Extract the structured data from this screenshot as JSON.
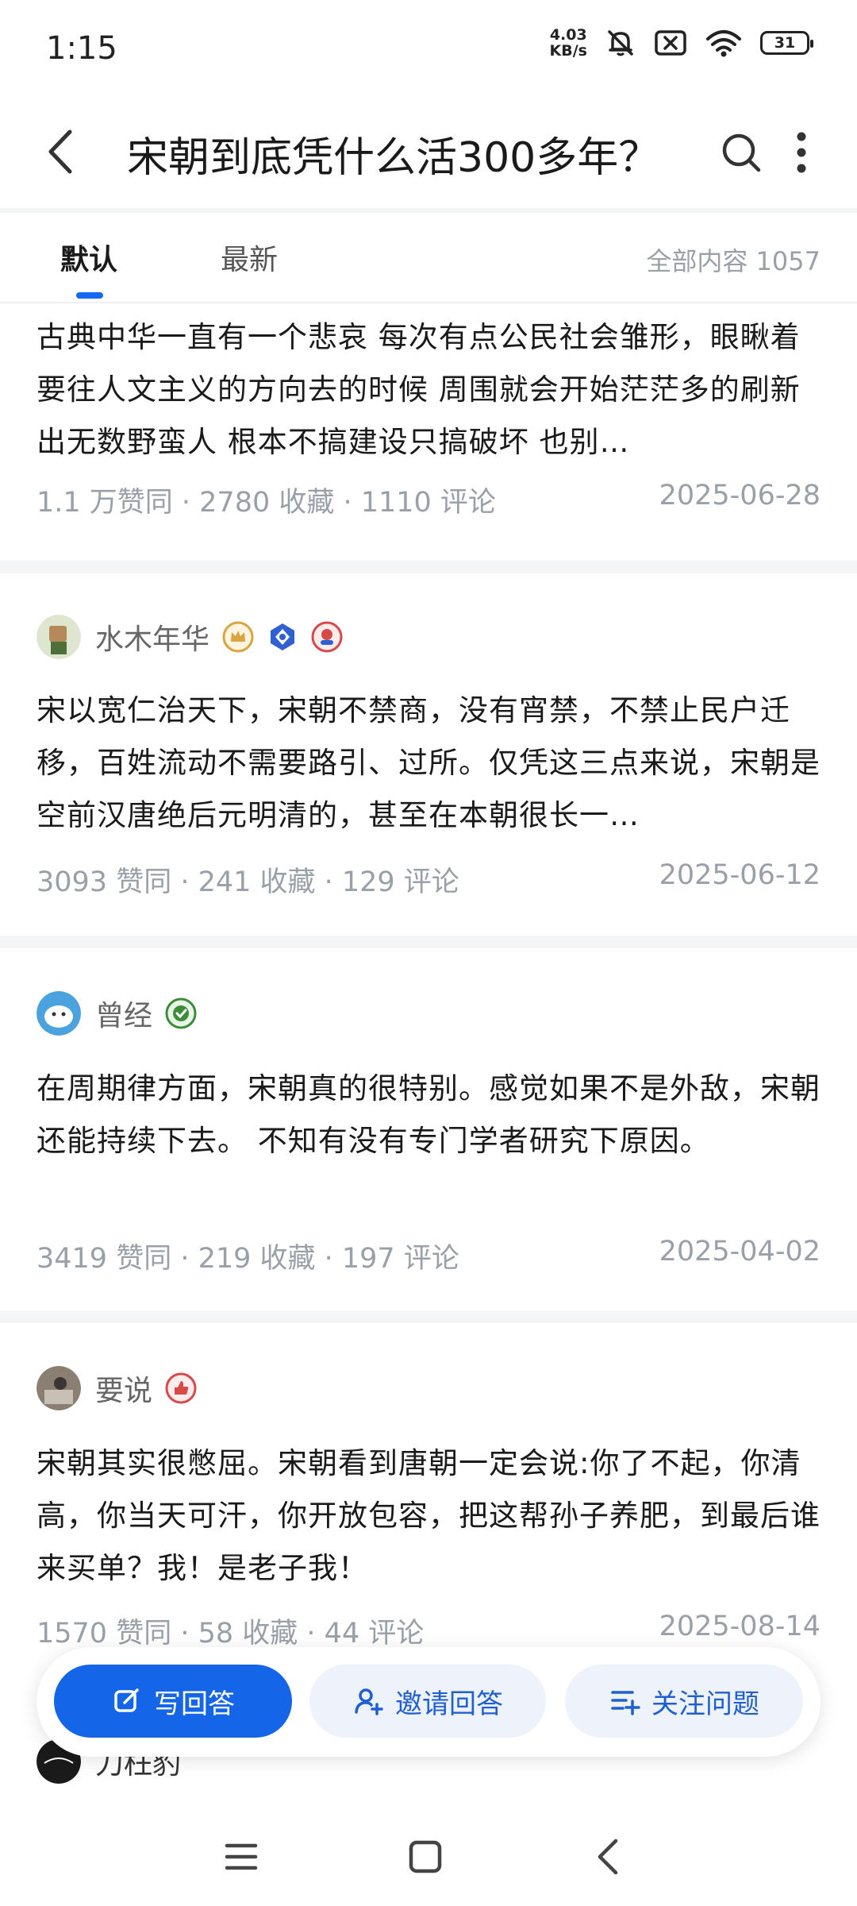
{
  "status_bar": {
    "time": "1:15",
    "speed_value": "4.03",
    "speed_unit": "KB/s",
    "battery": "31"
  },
  "header": {
    "title": "宋朝到底凭什么活300多年？"
  },
  "tabs": {
    "default_label": "默认",
    "latest_label": "最新",
    "total_label": "全部内容 1057"
  },
  "answers": [
    {
      "text": "古典中华一直有一个悲哀 每次有点公民社会雏形，眼瞅着要往人文主义的方向去的时候 周围就会开始茫茫多的刷新出无数野蛮人 根本不搞建设只搞破坏 也别…",
      "meta": "1.1 万赞同 · 2780 收藏 · 1110 评论",
      "date": "2025-06-28"
    },
    {
      "author": "水木年华",
      "text": "宋以宽仁治天下，宋朝不禁商，没有宵禁，不禁止民户迁移，百姓流动不需要路引、过所。仅凭这三点来说，宋朝是空前汉唐绝后元明清的，甚至在本朝很长一…",
      "meta": "3093 赞同 · 241 收藏 · 129 评论",
      "date": "2025-06-12"
    },
    {
      "author": "曾经",
      "text": "在周期律方面，宋朝真的很特别。感觉如果不是外敌，宋朝还能持续下去。 不知有没有专门学者研究下原因。",
      "meta": "3419 赞同 · 219 收藏 · 197 评论",
      "date": "2025-04-02"
    },
    {
      "author": "要说",
      "text": "宋朝其实很憋屈。宋朝看到唐朝一定会说:你了不起，你清高，你当天可汗，你开放包容，把这帮孙子养肥，到最后谁来买单？我！是老子我！",
      "meta": "1570 赞同 · 58 收藏 · 44 评论",
      "date": "2025-08-14"
    },
    {
      "author": "刀枉豹"
    }
  ],
  "actions": {
    "write_label": "写回答",
    "invite_label": "邀请回答",
    "follow_label": "关注问题"
  },
  "colors": {
    "accent": "#1565e9",
    "muted_text": "#9aa0a8"
  }
}
